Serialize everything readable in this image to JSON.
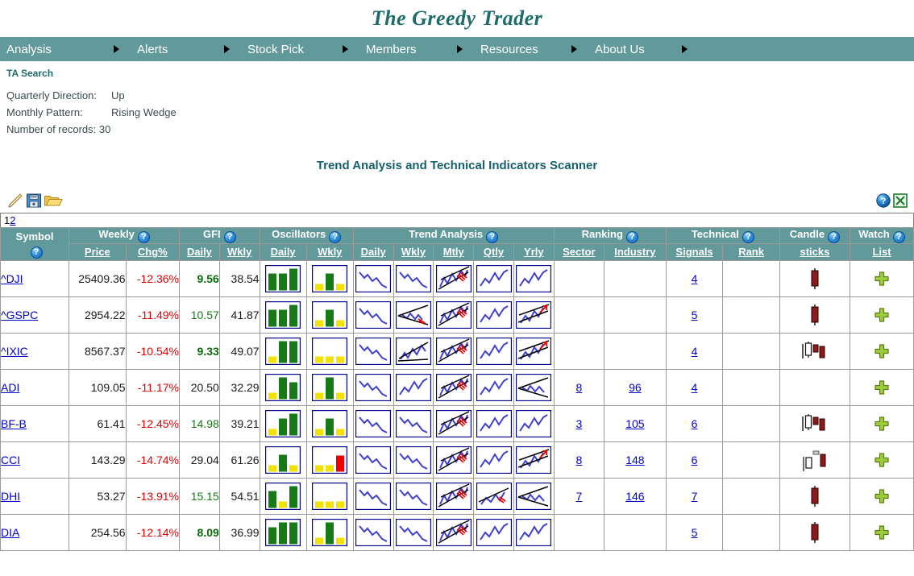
{
  "site": {
    "title": "The Greedy Trader",
    "nav": [
      {
        "label": "Analysis"
      },
      {
        "label": "Alerts"
      },
      {
        "label": "Stock Pick"
      },
      {
        "label": "Members"
      },
      {
        "label": "Resources"
      },
      {
        "label": "About Us"
      }
    ]
  },
  "breadcrumb": "TA Search",
  "criteria": [
    {
      "label": "Quarterly Direction:",
      "value": "Up"
    },
    {
      "label": "Monthly Pattern:",
      "value": "Rising Wedge"
    },
    {
      "label": "Number of records:",
      "value": "30"
    }
  ],
  "scanner_title": "Trend Analysis and Technical Indicators Scanner",
  "toolbar": {
    "edit_icon": "pencil-icon",
    "save_icon": "floppy-disk-icon",
    "open_icon": "folder-open-icon",
    "help_icon": "help-icon",
    "excel_icon": "excel-export-icon"
  },
  "pager": {
    "current": "1",
    "links": [
      "2"
    ]
  },
  "table": {
    "groups": [
      {
        "label": "Symbol",
        "help": "?",
        "span": 1
      },
      {
        "label": "Weekly",
        "help": "?",
        "span": 2
      },
      {
        "label": "GFI",
        "help": "?",
        "span": 2
      },
      {
        "label": "Oscillators",
        "help": "?",
        "span": 2
      },
      {
        "label": "Trend Analysis",
        "help": "?",
        "span": 5
      },
      {
        "label": "Ranking",
        "help": "?",
        "span": 2
      },
      {
        "label": "Technical",
        "help": "?",
        "span": 2
      },
      {
        "label": "Candle",
        "help": "?",
        "span": 1
      },
      {
        "label": "Watch",
        "help": "?",
        "span": 1
      }
    ],
    "subheaders": [
      "",
      "Price",
      "Chg%",
      "Daily",
      "Wkly",
      "Daily",
      "Wkly",
      "Daily",
      "Wkly",
      "Mtly",
      "Qtly",
      "Yrly",
      "Sector",
      "Industry",
      "Signals",
      "Rank",
      "sticks",
      "List"
    ],
    "rows": [
      {
        "symbol": "^DJI",
        "price": "25409.36",
        "chg": "-12.36%",
        "gfi_daily": "9.56",
        "gfi_daily_style": "green-bold",
        "gfi_wkly": "38.54",
        "osc_daily": [
          "green",
          "green",
          "green-tall"
        ],
        "osc_wkly": [
          "yellow",
          "green",
          "yellow"
        ],
        "trend": [
          "down",
          "down",
          "up-wedge-red",
          "up",
          "up"
        ],
        "sector": "",
        "industry": "",
        "signals": "4",
        "rank": "",
        "candle": "single-red",
        "watch": "add-icon"
      },
      {
        "symbol": "^GSPC",
        "price": "2954.22",
        "chg": "-11.49%",
        "gfi_daily": "10.57",
        "gfi_daily_style": "green",
        "gfi_wkly": "41.87",
        "osc_daily": [
          "green",
          "green",
          "green-tall"
        ],
        "osc_wkly": [
          "yellow",
          "green",
          "yellow"
        ],
        "trend": [
          "down",
          "wedge-falling-red",
          "up-wedge-red",
          "up",
          "up-arrow-red"
        ],
        "sector": "",
        "industry": "",
        "signals": "5",
        "rank": "",
        "candle": "single-red",
        "watch": "add-icon"
      },
      {
        "symbol": "^IXIC",
        "price": "8567.37",
        "chg": "-10.54%",
        "gfi_daily": "9.33",
        "gfi_daily_style": "green-bold",
        "gfi_wkly": "49.07",
        "osc_daily": [
          "yellow",
          "green-tall",
          "green-tall"
        ],
        "osc_wkly": [
          "yellow",
          "yellow",
          "yellow"
        ],
        "trend": [
          "down",
          "rising-wedge",
          "up-wedge-red",
          "up",
          "up-arrow-red"
        ],
        "sector": "",
        "industry": "",
        "signals": "4",
        "rank": "",
        "candle": "three-candles",
        "watch": "add-icon"
      },
      {
        "symbol": "ADI",
        "price": "109.05",
        "chg": "-11.17%",
        "gfi_daily": "20.50",
        "gfi_daily_style": "plain",
        "gfi_wkly": "32.29",
        "osc_daily": [
          "yellow",
          "green-tall",
          "green"
        ],
        "osc_wkly": [
          "yellow",
          "green-tall",
          "yellow"
        ],
        "trend": [
          "down",
          "up",
          "up-wedge-red",
          "up",
          "wedge-falling"
        ],
        "sector": "8",
        "industry": "96",
        "signals": "4",
        "rank": "",
        "candle": "none",
        "watch": "add-icon"
      },
      {
        "symbol": "BF-B",
        "price": "61.41",
        "chg": "-12.45%",
        "gfi_daily": "14.98",
        "gfi_daily_style": "green",
        "gfi_wkly": "39.21",
        "osc_daily": [
          "yellow",
          "green",
          "green-tall"
        ],
        "osc_wkly": [
          "yellow",
          "green",
          "yellow"
        ],
        "trend": [
          "down",
          "down",
          "up-wedge-red",
          "up",
          "up"
        ],
        "sector": "3",
        "industry": "105",
        "signals": "6",
        "rank": "",
        "candle": "three-candles",
        "watch": "add-icon"
      },
      {
        "symbol": "CCI",
        "price": "143.29",
        "chg": "-14.74%",
        "gfi_daily": "29.04",
        "gfi_daily_style": "plain",
        "gfi_wkly": "61.26",
        "osc_daily": [
          "yellow",
          "green",
          "yellow"
        ],
        "osc_wkly": [
          "yellow",
          "yellow",
          "red"
        ],
        "trend": [
          "down",
          "down",
          "up-wedge-red",
          "up",
          "up-arrow-red"
        ],
        "sector": "8",
        "industry": "148",
        "signals": "6",
        "rank": "",
        "candle": "three-candles-alt",
        "watch": "add-icon"
      },
      {
        "symbol": "DHI",
        "price": "53.27",
        "chg": "-13.91%",
        "gfi_daily": "15.15",
        "gfi_daily_style": "green",
        "gfi_wkly": "54.51",
        "osc_daily": [
          "green",
          "yellow",
          "green-tall"
        ],
        "osc_wkly": [
          "yellow",
          "yellow",
          "yellow"
        ],
        "trend": [
          "down",
          "down",
          "up-wedge-red",
          "up-trend-red",
          "wedge-falling"
        ],
        "sector": "7",
        "industry": "146",
        "signals": "7",
        "rank": "",
        "candle": "single-red",
        "watch": "add-icon"
      },
      {
        "symbol": "DIA",
        "price": "254.56",
        "chg": "-12.14%",
        "gfi_daily": "8.09",
        "gfi_daily_style": "green-bold",
        "gfi_wkly": "36.99",
        "osc_daily": [
          "green",
          "green-tall",
          "green-tall"
        ],
        "osc_wkly": [
          "yellow",
          "green-tall",
          "yellow"
        ],
        "trend": [
          "down",
          "down",
          "up-wedge-red",
          "up",
          "up"
        ],
        "sector": "",
        "industry": "",
        "signals": "5",
        "rank": "",
        "candle": "single-red",
        "watch": "add-icon"
      }
    ]
  },
  "colors": {
    "teal": "#62999a",
    "title_teal": "#1d6b6b",
    "link_blue": "#0000cc",
    "negative_red": "#e00000",
    "positive_green": "#157a15",
    "bar_green": "#177a17",
    "bar_yellow": "#f2e200",
    "bar_red": "#ee0000",
    "spark_blue": "#4040d0",
    "candle_red": "#8b1a1a"
  }
}
